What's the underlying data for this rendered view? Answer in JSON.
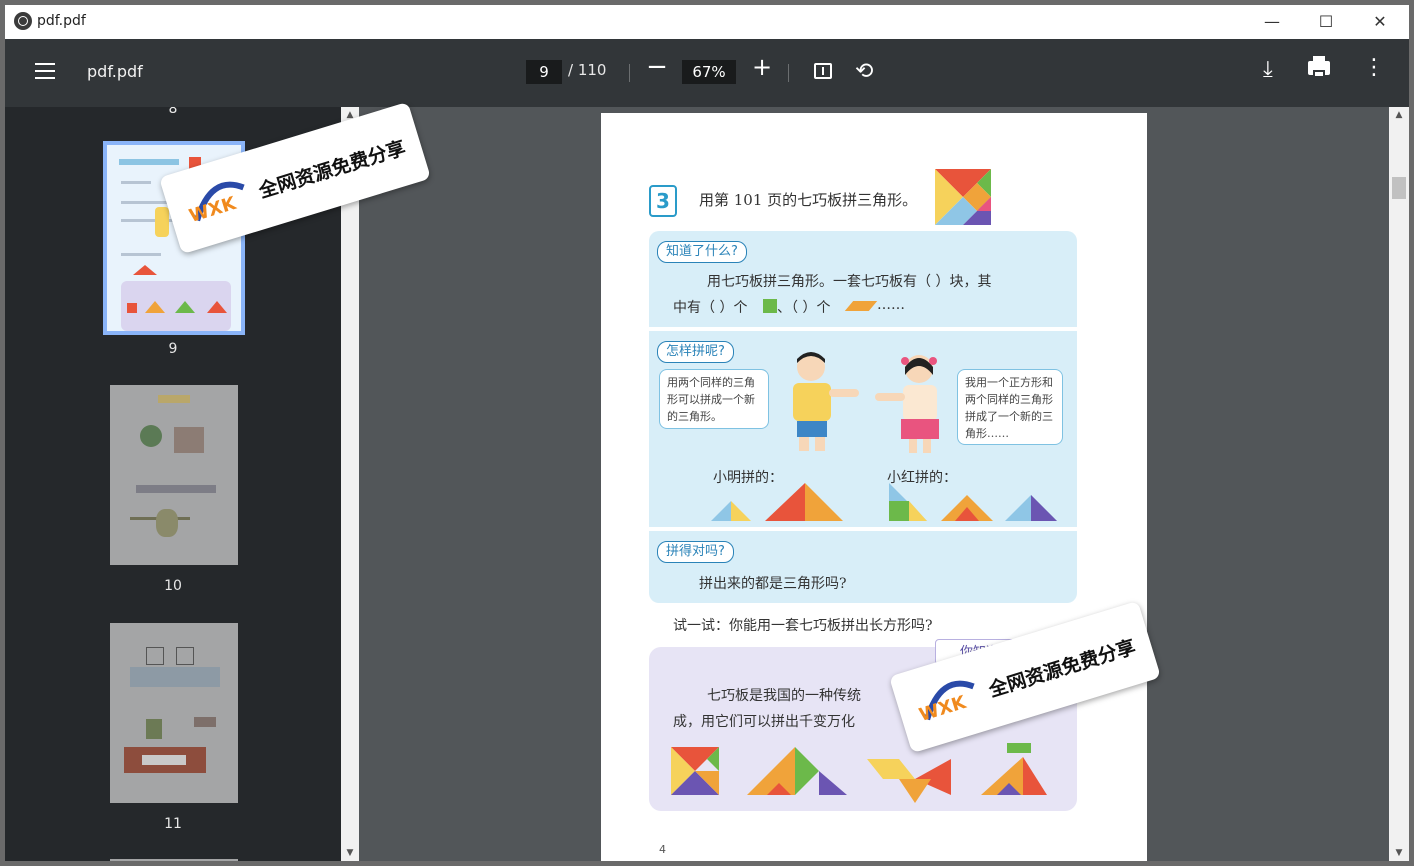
{
  "window": {
    "title": "pdf.pdf",
    "controls": {
      "minimize": "—",
      "maximize": "☐",
      "close": "✕"
    }
  },
  "toolbar": {
    "doc_title": "pdf.pdf",
    "page_current": "9",
    "page_total": "/ 110",
    "zoom": "67%",
    "zoom_out": "−",
    "zoom_in": "+"
  },
  "sidebar": {
    "partial_top_label": "8",
    "thumbnails": [
      {
        "label": "9",
        "selected": true
      },
      {
        "label": "10",
        "selected": false
      },
      {
        "label": "11",
        "selected": false
      }
    ]
  },
  "page": {
    "exercise_number": "3",
    "exercise_title": "用第 101 页的七巧板拼三角形。",
    "sections": {
      "know": {
        "tag": "知道了什么?",
        "line1": "用七巧板拼三角形。一套七巧板有（  ）块，其",
        "line2_a": "中有（  ）个",
        "line2_b": "、（  ）个",
        "line2_c": "……"
      },
      "how": {
        "tag": "怎样拼呢?",
        "bubble_left": "用两个同样的三角形可以拼成一个新的三角形。",
        "bubble_right": "我用一个正方形和两个同样的三角形拼成了一个新的三角形……",
        "label_ming": "小明拼的：",
        "label_hong": "小红拼的："
      },
      "check": {
        "tag": "拼得对吗?",
        "text": "拼出来的都是三角形吗?"
      }
    },
    "try_text": "试一试：你能用一套七巧板拼出长方形吗?",
    "did_you_know": {
      "tag": "你知道",
      "line1": "七巧板是我国的一种传统",
      "line2": "成，用它们可以拼出千变万化"
    },
    "page_number": "4"
  },
  "watermarks": [
    {
      "text": "全网资源免费分享",
      "logo": "WXK"
    },
    {
      "text": "全网资源免费分享",
      "logo": "WXK"
    }
  ],
  "colors": {
    "toolbar_bg": "#323639",
    "sidebar_bg": "#25282b",
    "viewer_bg": "#525659",
    "selected_thumb": "#8ab4f8",
    "panel_blue": "#d8eef8",
    "panel_purple": "#e7e4f5"
  }
}
